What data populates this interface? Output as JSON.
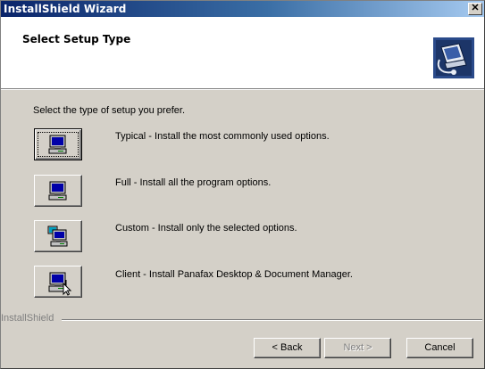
{
  "window": {
    "title": "InstallShield Wizard",
    "close_glyph": "✕"
  },
  "header": {
    "title": "Select Setup Type",
    "icon": "computer-setup-icon"
  },
  "instruction": "Select the type of setup you prefer.",
  "options": [
    {
      "label": "Typical - Install the most commonly used options.",
      "icon": "computer-icon",
      "focused": true
    },
    {
      "label": "Full - Install all the program options.",
      "icon": "computer-icon",
      "focused": false
    },
    {
      "label": "Custom - Install only the selected options.",
      "icon": "custom-computer-icon",
      "focused": false
    },
    {
      "label": "Client - Install Panafax Desktop & Document Manager.",
      "icon": "client-computer-icon",
      "focused": false
    }
  ],
  "footer": {
    "brand": "InstallShield",
    "back_label": "< Back",
    "next_label": "Next >",
    "cancel_label": "Cancel",
    "next_disabled": true
  }
}
